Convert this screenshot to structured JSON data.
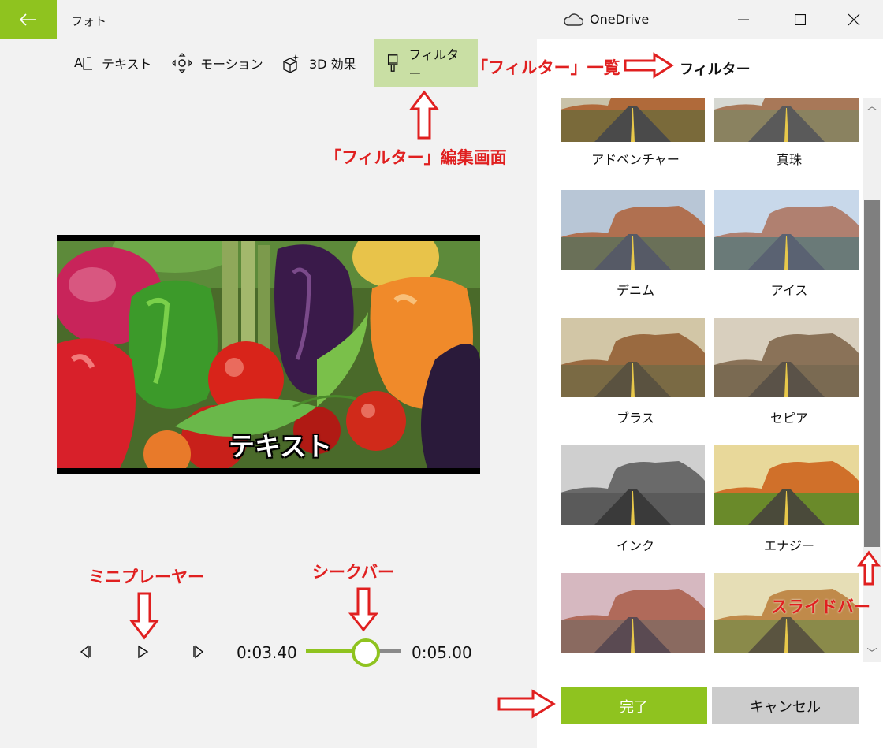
{
  "titlebar": {
    "app_title": "フォト",
    "onedrive_label": "OneDrive",
    "back_icon": "arrow-left-icon",
    "minimize_icon": "minimize-icon",
    "maximize_icon": "maximize-icon",
    "close_icon": "close-icon"
  },
  "toolbar": {
    "items": [
      {
        "label": "テキスト",
        "icon": "text-icon"
      },
      {
        "label": "モーション",
        "icon": "motion-icon"
      },
      {
        "label": "3D 効果",
        "icon": "3d-effects-icon"
      },
      {
        "label": "フィルター",
        "icon": "filter-brush-icon",
        "active": true
      }
    ]
  },
  "preview": {
    "overlay_text": "テキスト"
  },
  "player": {
    "current_time": "0:03.40",
    "total_time": "0:05.00",
    "progress": 0.68
  },
  "panel": {
    "title": "フィルター",
    "filters": [
      {
        "label": "アドベンチャー",
        "tone": "adventure"
      },
      {
        "label": "真珠",
        "tone": "pearl"
      },
      {
        "label": "デニム",
        "tone": "denim"
      },
      {
        "label": "アイス",
        "tone": "ice"
      },
      {
        "label": "ブラス",
        "tone": "brass"
      },
      {
        "label": "セピア",
        "tone": "sepia"
      },
      {
        "label": "インク",
        "tone": "ink"
      },
      {
        "label": "エナジー",
        "tone": "energy"
      },
      {
        "label": "",
        "tone": "rose"
      },
      {
        "label": "",
        "tone": "retro"
      }
    ],
    "done_label": "完了",
    "cancel_label": "キャンセル"
  },
  "annotations": {
    "filter_list": "「フィルター」一覧",
    "filter_edit_screen": "「フィルター」編集画面",
    "mini_player": "ミニプレーヤー",
    "seek_bar": "シークバー",
    "slide_bar": "スライドバー"
  },
  "colors": {
    "accent": "#8fc31f",
    "annotation": "#e02020"
  }
}
